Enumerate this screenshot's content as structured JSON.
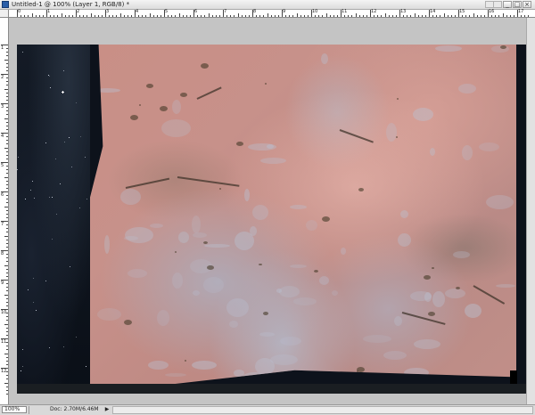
{
  "window": {
    "title": "Untitled-1 @ 100% (Layer 1, RGB/8) *",
    "minimize_glyph": "_",
    "maximize_glyph": "□",
    "close_glyph": "×"
  },
  "status": {
    "zoom": "100%",
    "doc_info": "Doc: 2.70M/6.46M",
    "menu_arrow": "▶"
  },
  "ruler": {
    "top_labels": [
      "0",
      "1",
      "2",
      "3",
      "4",
      "5",
      "6",
      "7",
      "8",
      "9",
      "10",
      "11",
      "12",
      "13",
      "14",
      "15",
      "16",
      "17"
    ],
    "left_labels": [
      "1",
      "2",
      "3",
      "4",
      "5",
      "6",
      "7",
      "8",
      "9",
      "10",
      "11",
      "12"
    ]
  },
  "colors": {
    "canvas_bg": "#c4c4c4",
    "rock": "#c98f86",
    "space": "#0d121b"
  }
}
